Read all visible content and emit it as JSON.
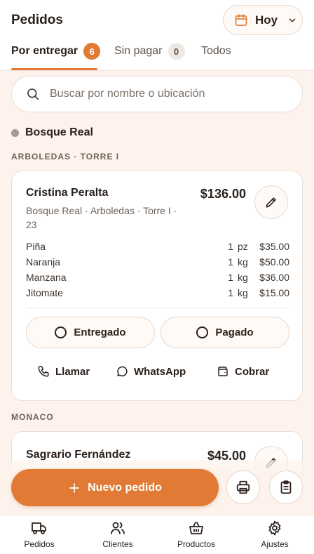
{
  "header": {
    "title": "Pedidos",
    "date_filter": "Hoy"
  },
  "tabs": [
    {
      "label": "Por entregar",
      "count": "6",
      "active": true
    },
    {
      "label": "Sin pagar",
      "count": "0",
      "active": false
    },
    {
      "label": "Todos",
      "active": false
    }
  ],
  "search": {
    "placeholder": "Buscar por nombre o ubicación",
    "value": ""
  },
  "location": {
    "name": "Bosque Real"
  },
  "groups": [
    {
      "label": "ARBOLEDAS · TORRE I",
      "order": {
        "customer": "Cristina Peralta",
        "address": "Bosque Real · Arboledas · Torre I · 23",
        "total": "$136.00",
        "items": [
          {
            "name": "Piña",
            "qty": "1",
            "unit": "pz",
            "price": "$35.00"
          },
          {
            "name": "Naranja",
            "qty": "1",
            "unit": "kg",
            "price": "$50.00"
          },
          {
            "name": "Manzana",
            "qty": "1",
            "unit": "kg",
            "price": "$36.00"
          },
          {
            "name": "Jitomate",
            "qty": "1",
            "unit": "kg",
            "price": "$15.00"
          }
        ],
        "status_buttons": [
          "Entregado",
          "Pagado"
        ],
        "actions": [
          "Llamar",
          "WhatsApp",
          "Cobrar"
        ]
      }
    },
    {
      "label": "MONACO",
      "order": {
        "customer": "Sagrario Fernández",
        "total": "$45.00"
      }
    }
  ],
  "fab": {
    "new_order": "Nuevo pedido"
  },
  "nav": [
    {
      "label": "Pedidos",
      "icon": "truck-icon"
    },
    {
      "label": "Clientes",
      "icon": "users-icon"
    },
    {
      "label": "Productos",
      "icon": "basket-icon"
    },
    {
      "label": "Ajustes",
      "icon": "gear-icon"
    }
  ],
  "colors": {
    "accent": "#e07a34",
    "background": "#fdf3ec",
    "text": "#2a211c"
  }
}
